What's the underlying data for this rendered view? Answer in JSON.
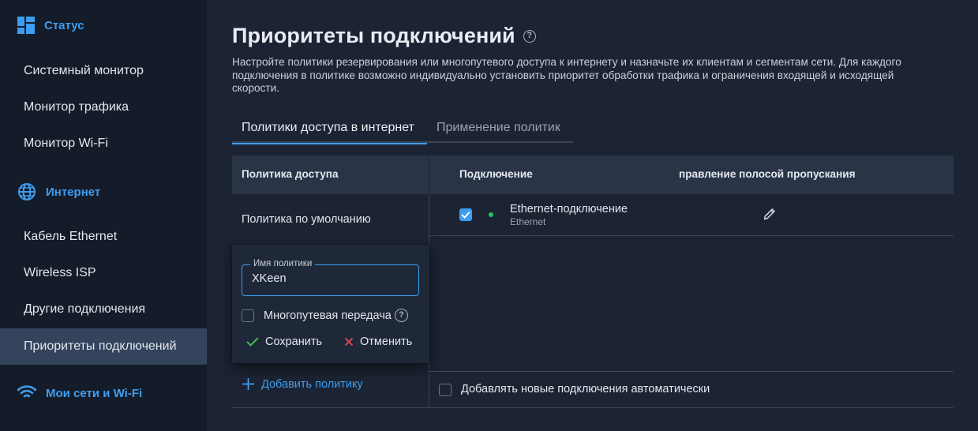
{
  "sidebar": {
    "sections": [
      {
        "title": "Статус",
        "icon": "dashboard-icon",
        "items": [
          {
            "label": "Системный монитор"
          },
          {
            "label": "Монитор трафика"
          },
          {
            "label": "Монитор Wi-Fi"
          }
        ]
      },
      {
        "title": "Интернет",
        "icon": "globe-icon",
        "items": [
          {
            "label": "Кабель Ethernet"
          },
          {
            "label": "Wireless ISP"
          },
          {
            "label": "Другие подключения"
          },
          {
            "label": "Приоритеты подключений",
            "active": true
          }
        ]
      },
      {
        "title": "Мои сети и Wi-Fi",
        "icon": "wifi-icon",
        "items": []
      }
    ]
  },
  "main": {
    "title": "Приоритеты подключений",
    "description": "Настройте политики резервирования или многопутевого доступа к интернету и назначьте их клиентам и сегментам сети. Для каждого подключения в политике возможно индивидуально установить приоритет обработки трафика и ограничения входящей и исходящей скорости.",
    "tabs": [
      {
        "label": "Политики доступа в интернет",
        "active": true
      },
      {
        "label": "Применение политик",
        "active": false
      }
    ],
    "table": {
      "headers": [
        "Политика доступа",
        "Подключение",
        "правление полосой пропускания"
      ],
      "policies": [
        {
          "name": "Политика по умолчанию"
        }
      ],
      "connections": [
        {
          "name": "Ethernet-подключение",
          "type": "Ethernet",
          "checked": true,
          "status": "connected"
        }
      ],
      "add_policy_label": "Добавить политику",
      "auto_add_label": "Добавлять новые подключения автоматически",
      "auto_add_checked": false
    },
    "edit_form": {
      "field_label": "Имя политики",
      "field_value": "XKeen",
      "multipath_label": "Многопутевая передача",
      "multipath_checked": false,
      "save_label": "Сохранить",
      "cancel_label": "Отменить"
    }
  },
  "colors": {
    "accent": "#3d9df0",
    "sidebar_bg": "#151c29",
    "main_bg": "#1c2433",
    "header_bg": "#2a3447",
    "active_item_bg": "#34445d",
    "status_connected": "#22c55e",
    "cancel_red": "#e5484d",
    "save_green": "#3fb950"
  }
}
